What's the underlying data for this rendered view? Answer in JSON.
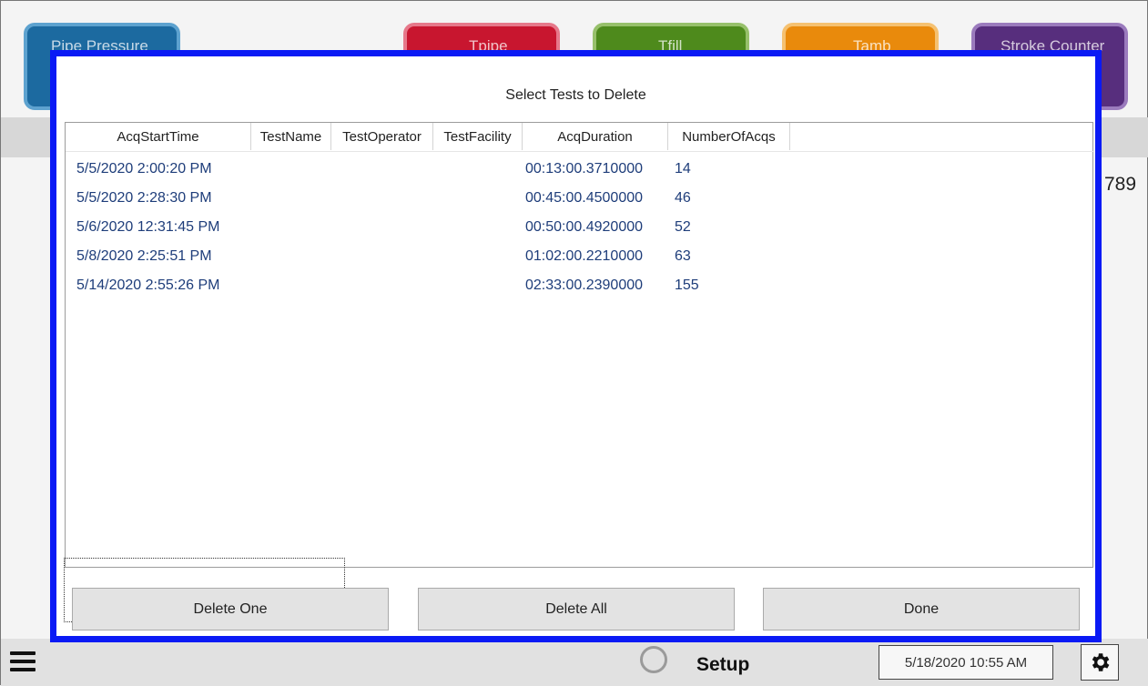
{
  "tiles": [
    {
      "label": "Pipe Pressure",
      "color": "#1c6aa0"
    },
    {
      "label": "Tpipe",
      "color": "#c8162f"
    },
    {
      "label": "Tfill",
      "color": "#4e8a1c"
    },
    {
      "label": "Tamb",
      "color": "#e98a0c"
    },
    {
      "label": "Stroke Counter",
      "color": "#572e7d"
    }
  ],
  "side_number": "789",
  "dialog": {
    "title": "Select Tests to Delete",
    "border_color": "#0a1af5",
    "columns": [
      "AcqStartTime",
      "TestName",
      "TestOperator",
      "TestFacility",
      "AcqDuration",
      "NumberOfAcqs"
    ],
    "rows": [
      {
        "AcqStartTime": "5/5/2020 2:00:20 PM",
        "TestName": "",
        "TestOperator": "",
        "TestFacility": "",
        "AcqDuration": "00:13:00.3710000",
        "NumberOfAcqs": "14"
      },
      {
        "AcqStartTime": "5/5/2020 2:28:30 PM",
        "TestName": "",
        "TestOperator": "",
        "TestFacility": "",
        "AcqDuration": "00:45:00.4500000",
        "NumberOfAcqs": "46"
      },
      {
        "AcqStartTime": "5/6/2020 12:31:45 PM",
        "TestName": "",
        "TestOperator": "",
        "TestFacility": "",
        "AcqDuration": "00:50:00.4920000",
        "NumberOfAcqs": "52"
      },
      {
        "AcqStartTime": "5/8/2020 2:25:51 PM",
        "TestName": "",
        "TestOperator": "",
        "TestFacility": "",
        "AcqDuration": "01:02:00.2210000",
        "NumberOfAcqs": "63"
      },
      {
        "AcqStartTime": "5/14/2020 2:55:26 PM",
        "TestName": "",
        "TestOperator": "",
        "TestFacility": "",
        "AcqDuration": "02:33:00.2390000",
        "NumberOfAcqs": "155"
      }
    ],
    "buttons": {
      "delete_one": "Delete One",
      "delete_all": "Delete All",
      "done": "Done"
    }
  },
  "status_bar": {
    "menu_icon": "hamburger-menu-icon",
    "status_indicator_icon": "status-circle-icon",
    "mode": "Setup",
    "datetime": "5/18/2020 10:55 AM",
    "settings_icon": "gear-icon"
  }
}
